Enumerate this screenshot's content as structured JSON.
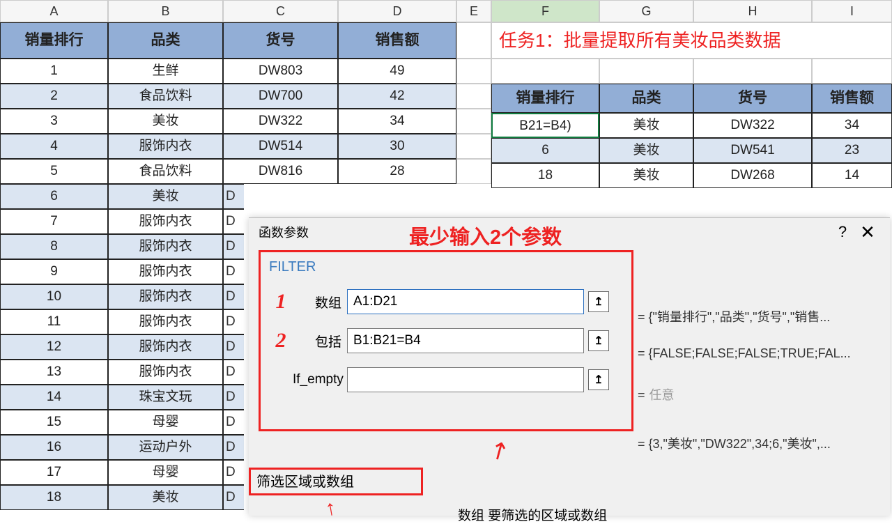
{
  "columns": [
    "A",
    "B",
    "C",
    "D",
    "E",
    "F",
    "G",
    "H",
    "I"
  ],
  "headers_left": [
    "销量排行",
    "品类",
    "货号",
    "销售额"
  ],
  "rows_left": [
    {
      "r": "1",
      "b": "生鲜",
      "c": "DW803",
      "d": "49",
      "alt": false
    },
    {
      "r": "2",
      "b": "食品饮料",
      "c": "DW700",
      "d": "42",
      "alt": true
    },
    {
      "r": "3",
      "b": "美妆",
      "c": "DW322",
      "d": "34",
      "alt": false
    },
    {
      "r": "4",
      "b": "服饰内衣",
      "c": "DW514",
      "d": "30",
      "alt": true
    },
    {
      "r": "5",
      "b": "食品饮料",
      "c": "DW816",
      "d": "28",
      "alt": false
    },
    {
      "r": "6",
      "b": "美妆",
      "c": "D",
      "d": "",
      "alt": true,
      "cut": true
    },
    {
      "r": "7",
      "b": "服饰内衣",
      "c": "D",
      "d": "",
      "alt": false,
      "cut": true
    },
    {
      "r": "8",
      "b": "服饰内衣",
      "c": "D",
      "d": "",
      "alt": true,
      "cut": true
    },
    {
      "r": "9",
      "b": "服饰内衣",
      "c": "D",
      "d": "",
      "alt": false,
      "cut": true
    },
    {
      "r": "10",
      "b": "服饰内衣",
      "c": "D",
      "d": "",
      "alt": true,
      "cut": true
    },
    {
      "r": "11",
      "b": "服饰内衣",
      "c": "D",
      "d": "",
      "alt": false,
      "cut": true
    },
    {
      "r": "12",
      "b": "服饰内衣",
      "c": "D",
      "d": "",
      "alt": true,
      "cut": true
    },
    {
      "r": "13",
      "b": "服饰内衣",
      "c": "D",
      "d": "",
      "alt": false,
      "cut": true
    },
    {
      "r": "14",
      "b": "珠宝文玩",
      "c": "D",
      "d": "",
      "alt": true,
      "cut": true
    },
    {
      "r": "15",
      "b": "母婴",
      "c": "D",
      "d": "",
      "alt": false,
      "cut": true
    },
    {
      "r": "16",
      "b": "运动户外",
      "c": "D",
      "d": "",
      "alt": true,
      "cut": true
    },
    {
      "r": "17",
      "b": "母婴",
      "c": "D",
      "d": "",
      "alt": false,
      "cut": true
    },
    {
      "r": "18",
      "b": "美妆",
      "c": "D",
      "d": "",
      "alt": true,
      "cut": true
    }
  ],
  "task_text": "任务1：批量提取所有美妆品类数据",
  "headers_right": [
    "销量排行",
    "品类",
    "货号",
    "销售额"
  ],
  "rows_right": [
    {
      "f": "B21=B4)",
      "g": "美妆",
      "h": "DW322",
      "i": "34",
      "alt": false,
      "sel": true
    },
    {
      "f": "6",
      "g": "美妆",
      "h": "DW541",
      "i": "23",
      "alt": true
    },
    {
      "f": "18",
      "g": "美妆",
      "h": "DW268",
      "i": "14",
      "alt": false
    }
  ],
  "dialog": {
    "title": "函数参数",
    "annotation": "最少输入2个参数",
    "func_name": "FILTER",
    "params": [
      {
        "num": "1",
        "label": "数组",
        "value": "A1:D21",
        "result": "= {\"销量排行\",\"品类\",\"货号\",\"销售...",
        "sel": true
      },
      {
        "num": "2",
        "label": "包括",
        "value": "B1:B21=B4",
        "result": "= {FALSE;FALSE;FALSE;TRUE;FAL..."
      },
      {
        "num": "",
        "label": "If_empty",
        "value": "",
        "result": "= 任意",
        "gray": true
      }
    ],
    "final_result": "= {3,\"美妆\",\"DW322\",34;6,\"美妆\",...",
    "desc": "筛选区域或数组",
    "bottom": "数组  要筛选的区域或数组",
    "pick_glyph": "↥"
  }
}
